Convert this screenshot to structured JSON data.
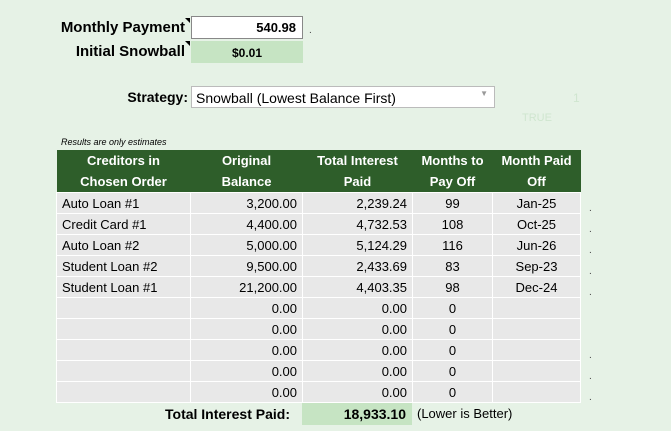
{
  "inputs": {
    "monthly_payment_label": "Monthly Payment",
    "monthly_payment_value": "540.98",
    "initial_snowball_label": "Initial Snowball",
    "initial_snowball_value": "$0.01"
  },
  "strategy": {
    "label": "Strategy:",
    "selected": "Snowball (Lowest Balance First)",
    "faint_number": "1",
    "faint_text": "TRUE"
  },
  "note": "Results are only estimates",
  "table": {
    "headers": [
      [
        "Creditors in",
        "Chosen Order"
      ],
      [
        "Original",
        "Balance"
      ],
      [
        "Total Interest",
        "Paid"
      ],
      [
        "Months to",
        "Pay Off"
      ],
      [
        "Month Paid",
        "Off"
      ]
    ],
    "rows": [
      [
        "Auto Loan #1",
        "3,200.00",
        "2,239.24",
        "99",
        "Jan-25"
      ],
      [
        "Credit Card #1",
        "4,400.00",
        "4,732.53",
        "108",
        "Oct-25"
      ],
      [
        "Auto Loan #2",
        "5,000.00",
        "5,124.29",
        "116",
        "Jun-26"
      ],
      [
        "Student Loan #2",
        "9,500.00",
        "2,433.69",
        "83",
        "Sep-23"
      ],
      [
        "Student Loan #1",
        "21,200.00",
        "4,403.35",
        "98",
        "Dec-24"
      ],
      [
        "",
        "0.00",
        "0.00",
        "0",
        ""
      ],
      [
        "",
        "0.00",
        "0.00",
        "0",
        ""
      ],
      [
        "",
        "0.00",
        "0.00",
        "0",
        ""
      ],
      [
        "",
        "0.00",
        "0.00",
        "0",
        ""
      ],
      [
        "",
        "0.00",
        "0.00",
        "0",
        ""
      ]
    ]
  },
  "summary": {
    "total_label": "Total Interest Paid:",
    "total_value": "18,933.10",
    "total_note": "(Lower is Better)"
  },
  "dot": "."
}
